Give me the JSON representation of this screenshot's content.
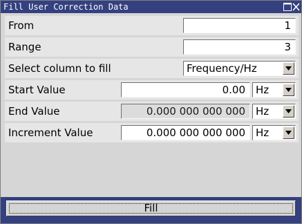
{
  "window": {
    "title": "Fill User Correction Data",
    "maximize_icon": "maximize-icon",
    "close_icon": "close-icon"
  },
  "form": {
    "from": {
      "label": "From",
      "value": "1"
    },
    "range": {
      "label": "Range",
      "value": "3"
    },
    "select_column": {
      "label": "Select column to fill",
      "value": "Frequency/Hz"
    },
    "start_value": {
      "label": "Start Value",
      "value": "0.00",
      "unit": "Hz"
    },
    "end_value": {
      "label": "End Value",
      "value": "0.000 000 000 000",
      "unit": "Hz"
    },
    "increment_value": {
      "label": "Increment Value",
      "value": "0.000 000 000 000",
      "unit": "Hz"
    }
  },
  "actions": {
    "fill_label": "Fill"
  },
  "colors": {
    "title_bar": "#34407f",
    "dialog_background": "#d6d6d6",
    "row_background": "#e6e6e6",
    "disabled_field": "#dcdcdc"
  }
}
